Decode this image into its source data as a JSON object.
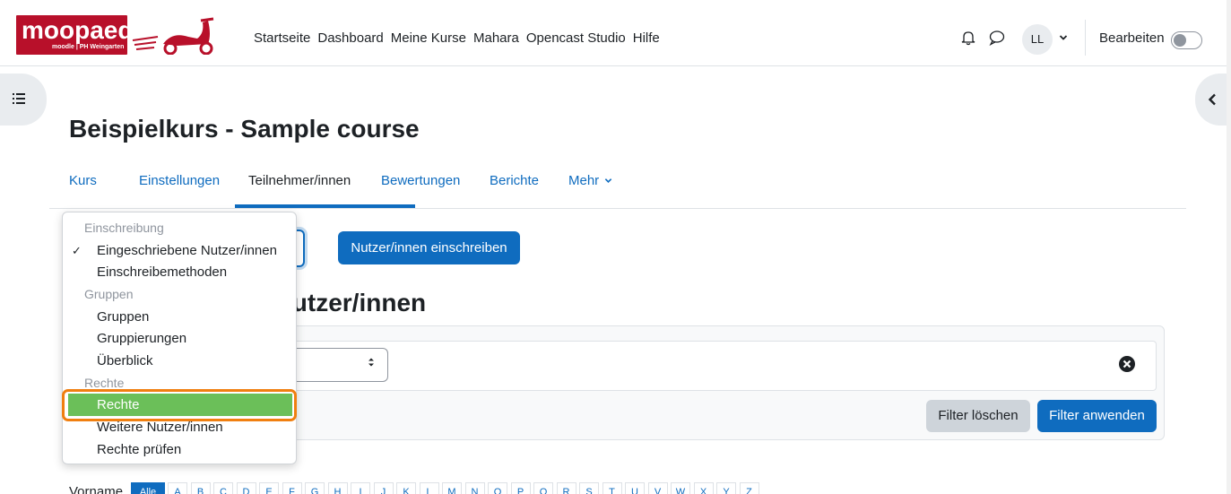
{
  "brand": {
    "logo_text": "moopaed",
    "logo_sub": "moodle | PH Weingarten",
    "color": "#b8102a"
  },
  "primary_nav": [
    "Startseite",
    "Dashboard",
    "Meine Kurse",
    "Mahara",
    "Opencast Studio",
    "Hilfe"
  ],
  "user": {
    "initials": "LL",
    "edit_label": "Bearbeiten",
    "edit_on": false
  },
  "icons": {
    "notifications": "bell-icon",
    "messages": "chat-icon",
    "user_menu": "chevron-down-icon",
    "left_drawer": "list-icon",
    "right_drawer": "chevron-left-icon",
    "filter_remove": "close-circle-icon"
  },
  "page": {
    "title": "Beispielkurs - Sample course",
    "heading_visible": "lutzer/innen"
  },
  "secondary_nav": {
    "items": [
      "Kurs",
      "Einstellungen",
      "Teilnehmer/innen",
      "Bewertungen",
      "Berichte",
      "Mehr"
    ],
    "active": "Teilnehmer/innen"
  },
  "actions": {
    "enrol_button": "Nutzer/innen einschreiben"
  },
  "filter": {
    "clear_label": "Filter löschen",
    "apply_label": "Filter anwenden"
  },
  "initials_bar": {
    "label": "Vorname",
    "all_label": "Alle",
    "letters": [
      "A",
      "B",
      "C",
      "D",
      "E",
      "F",
      "G",
      "H",
      "I",
      "J",
      "K",
      "L",
      "M",
      "N",
      "O",
      "P",
      "Q",
      "R",
      "S",
      "T",
      "U",
      "V",
      "W",
      "X",
      "Y",
      "Z"
    ]
  },
  "menu": {
    "items": [
      {
        "label": "Einschreibung",
        "type": "header"
      },
      {
        "label": "Eingeschriebene Nutzer/innen",
        "type": "item",
        "checked": true
      },
      {
        "label": "Einschreibemethoden",
        "type": "item"
      },
      {
        "label": "Gruppen",
        "type": "header"
      },
      {
        "label": "Gruppen",
        "type": "item"
      },
      {
        "label": "Gruppierungen",
        "type": "item"
      },
      {
        "label": "Überblick",
        "type": "item"
      },
      {
        "label": "Rechte",
        "type": "header"
      },
      {
        "label": "Rechte",
        "type": "item",
        "highlighted": true
      },
      {
        "label": "Weitere Nutzer/innen",
        "type": "item"
      },
      {
        "label": "Rechte prüfen",
        "type": "item"
      }
    ],
    "check_glyph": "✓"
  },
  "colors": {
    "primary": "#0f6cbf",
    "highlight_fill": "#6bbf59",
    "highlight_border": "#f07f10",
    "text": "#1d2125",
    "muted": "#8f959e"
  }
}
